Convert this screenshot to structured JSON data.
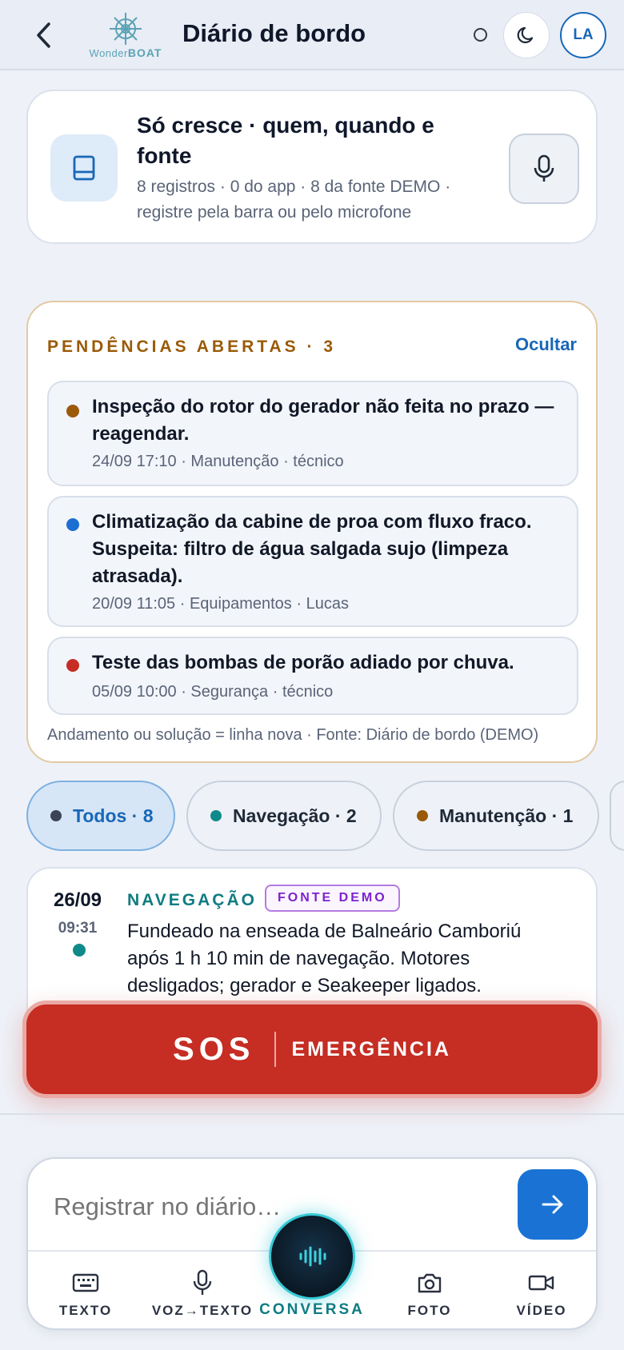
{
  "header": {
    "title": "Diário de bordo",
    "logo_text_a": "Wonder",
    "logo_text_b": "BOAT",
    "avatar_initials": "LA"
  },
  "summary": {
    "title": "Só cresce · quem, quando e fonte",
    "subtitle": "8 registros · 0 do app · 8 da fonte DEMO · registre pela barra ou pelo microfone"
  },
  "pending": {
    "title": "PENDÊNCIAS ABERTAS · 3",
    "hide_label": "Ocultar",
    "items": [
      {
        "text": "Inspeção do rotor do gerador não feita no prazo — reagendar.",
        "meta": "24/09 17:10 · Manutenção · técnico",
        "color": "#9a5a08"
      },
      {
        "text": "Climatização da cabine de proa com fluxo fraco. Suspeita: filtro de água salgada sujo (limpeza atrasada).",
        "meta": "20/09 11:05 · Equipamentos · Lucas",
        "color": "#1a6fd0"
      },
      {
        "text": "Teste das bombas de porão adiado por chuva.",
        "meta": "05/09 10:00 · Segurança · técnico",
        "color": "#c62d23"
      }
    ],
    "footer": "Andamento ou solução = linha nova · Fonte: Diário de bordo (DEMO)"
  },
  "filters": [
    {
      "label": "Todos · 8",
      "color": "#3c4456",
      "active": true
    },
    {
      "label": "Navegação · 2",
      "color": "#0f8a8a",
      "active": false
    },
    {
      "label": "Manutenção · 1",
      "color": "#9a5a08",
      "active": false
    }
  ],
  "entry": {
    "date": "26/09",
    "time": "09:31",
    "category": "NAVEGAÇÃO",
    "badge": "FONTE DEMO",
    "text": "Fundeado na enseada de Balneário Camboriú após 1 h 10 min de navegação. Motores desligados; gerador e Seakeeper ligados."
  },
  "sos": {
    "label": "SOS",
    "sublabel": "EMERGÊNCIA"
  },
  "composer": {
    "placeholder": "Registrar no diário…",
    "tools": {
      "text": "TEXTO",
      "voice_to_text": "VOZ→TEXTO",
      "conversation": "CONVERSA",
      "photo": "FOTO",
      "video": "VÍDEO"
    }
  },
  "colors": {
    "accent": "#1967b8",
    "sos": "#c62d23",
    "pending_title": "#9a5a08",
    "teal": "#0f7c82"
  }
}
